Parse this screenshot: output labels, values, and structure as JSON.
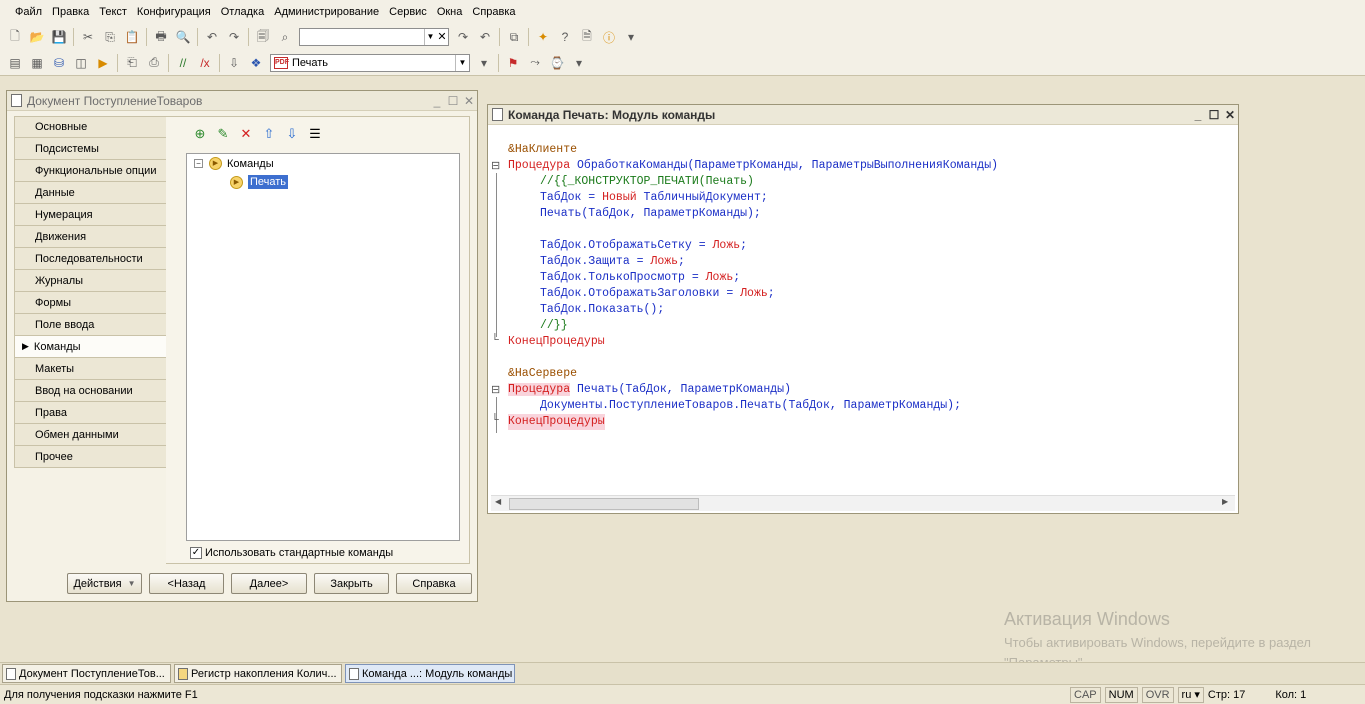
{
  "menu": [
    "Файл",
    "Правка",
    "Текст",
    "Конфигурация",
    "Отладка",
    "Администрирование",
    "Сервис",
    "Окна",
    "Справка"
  ],
  "toolbar2": {
    "command_combo_value": "Печать",
    "pdf_badge": "PDF"
  },
  "doc_window": {
    "title": "Документ ПоступлениеТоваров",
    "tabs": [
      "Основные",
      "Подсистемы",
      "Функциональные опции",
      "Данные",
      "Нумерация",
      "Движения",
      "Последовательности",
      "Журналы",
      "Формы",
      "Поле ввода",
      "Команды",
      "Макеты",
      "Ввод на основании",
      "Права",
      "Обмен данными",
      "Прочее"
    ],
    "active_tab": "Команды",
    "tree": {
      "root": "Команды",
      "child": "Печать"
    },
    "checkbox_label": "Использовать стандартные команды",
    "buttons": {
      "actions": "Действия",
      "back": "<Назад",
      "next": "Далее>",
      "close": "Закрыть",
      "help": "Справка"
    }
  },
  "module_window": {
    "title": "Команда Печать: Модуль команды",
    "code": {
      "l1": "&НаКлиенте",
      "l2_kw": "Процедура",
      "l2_name": "ОбработкаКоманды(ПараметрКоманды, ПараметрыВыполненияКоманды)",
      "l3": "//{{_КОНСТРУКТОР_ПЕЧАТИ(Печать)",
      "l4_a": "ТабДок = ",
      "l4_b": "Новый",
      "l4_c": " ТабличныйДокумент;",
      "l5": "Печать(ТабДок, ПараметрКоманды);",
      "l7_a": "ТабДок.ОтображатьСетку = ",
      "l7_b": "Ложь",
      "l8_a": "ТабДок.Защита = ",
      "l8_b": "Ложь",
      "l9_a": "ТабДок.ТолькоПросмотр = ",
      "l9_b": "Ложь",
      "l10_a": "ТабДок.ОтображатьЗаголовки = ",
      "l10_b": "Ложь",
      "l11": "ТабДок.Показать();",
      "l12": "//}}",
      "l13": "КонецПроцедуры",
      "l15": "&НаСервере",
      "l16_kw": "Процедура",
      "l16_name": "Печать(ТабДок, ПараметрКоманды)",
      "l17": "Документы.ПоступлениеТоваров.Печать(ТабДок, ПараметрКоманды);",
      "l18": "КонецПроцедуры",
      "semicolon": ";"
    }
  },
  "watermark": {
    "line1": "Активация Windows",
    "line2": "Чтобы активировать Windows, перейдите в раздел \"Параметры\"."
  },
  "taskbar": [
    "Документ ПоступлениеТов...",
    "Регистр накопления Колич...",
    "Команда ...: Модуль команды"
  ],
  "status": {
    "hint": "Для получения подсказки нажмите F1",
    "cap": "CAP",
    "num": "NUM",
    "ovr": "OVR",
    "lang": "ru ▾",
    "row": "Стр: 17",
    "col": "Кол: 1"
  }
}
